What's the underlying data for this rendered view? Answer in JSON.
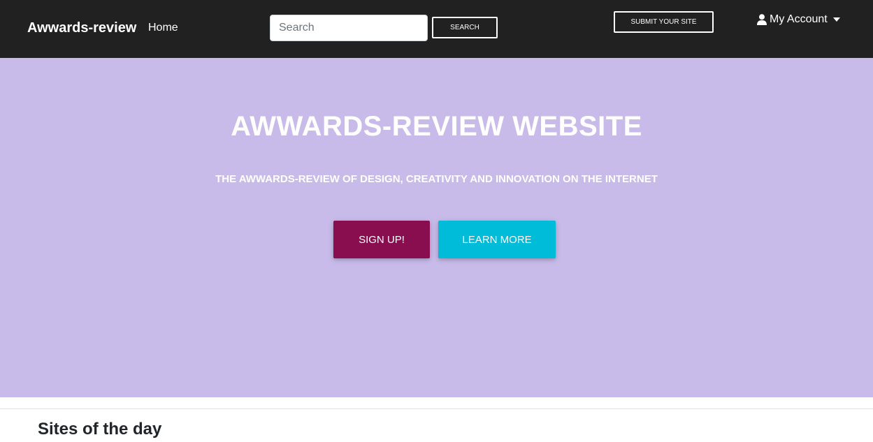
{
  "navbar": {
    "brand": "Awwards-review",
    "home_label": "Home",
    "search": {
      "placeholder": "Search",
      "value": "",
      "button_label": "SEARCH"
    },
    "submit_label": "SUBMIT YOUR SITE",
    "account": {
      "label": "My Account",
      "icon": "user-icon"
    },
    "colors": {
      "background": "#212121",
      "text": "#ffffff"
    }
  },
  "hero": {
    "title": "AWWARDS-REVIEW WEBSITE",
    "subtitle": "THE AWWARDS-REVIEW OF DESIGN, CREATIVITY AND INNOVATION ON THE INTERNET",
    "signup_label": "SIGN UP!",
    "learn_more_label": "LEARN MORE",
    "colors": {
      "background": "#c8bbea",
      "signup": "#880e4f",
      "learn_more": "#00bcd9"
    }
  },
  "main": {
    "section_title": "Sites of the day"
  }
}
